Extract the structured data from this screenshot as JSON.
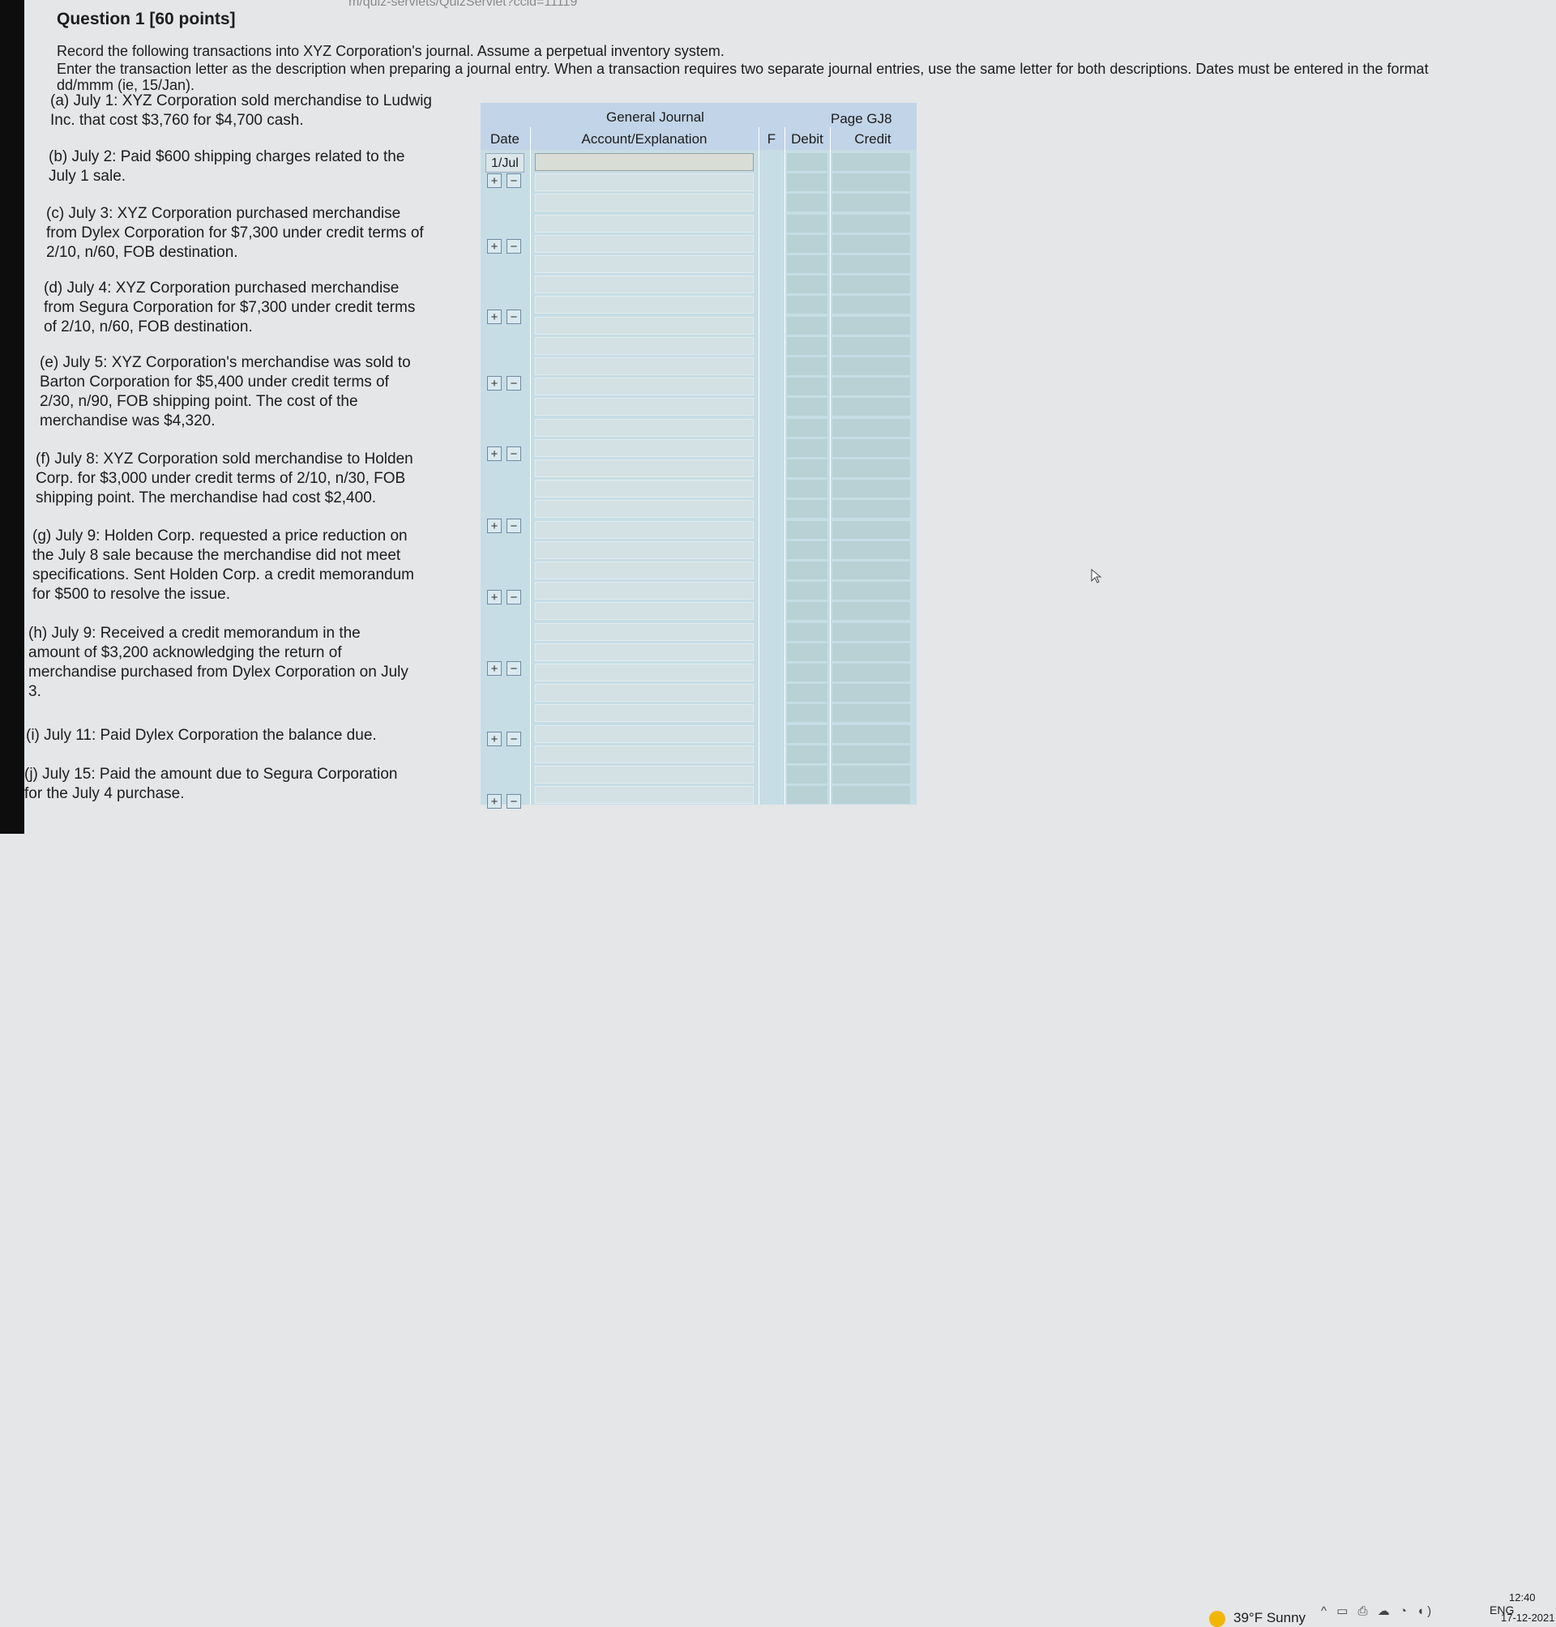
{
  "browser": {
    "url_fragment": "m/quiz-servlets/QuizServlet?ccid=11119"
  },
  "question": {
    "title": "Question 1 [60 points]",
    "instructions": [
      "Record the following transactions into XYZ Corporation's journal. Assume a perpetual inventory system.",
      "Enter the transaction letter as the description when preparing a journal entry. When a transaction requires two separate journal entries, use the same letter for both descriptions. Dates must be entered in the format",
      "dd/mmm (ie, 15/Jan)."
    ]
  },
  "transactions": [
    {
      "lines": [
        "(a) July 1: XYZ Corporation sold merchandise to Ludwig",
        "Inc. that cost $3,760 for $4,700 cash."
      ]
    },
    {
      "lines": [
        "(b) July 2: Paid $600 shipping charges related to the",
        "July 1 sale."
      ]
    },
    {
      "lines": [
        "(c) July 3: XYZ Corporation purchased merchandise",
        "from Dylex Corporation for $7,300 under credit terms of",
        "2/10, n/60, FOB destination."
      ]
    },
    {
      "lines": [
        "(d) July 4: XYZ Corporation purchased merchandise",
        "from Segura Corporation for $7,300 under credit terms",
        "of 2/10, n/60, FOB destination."
      ]
    },
    {
      "lines": [
        "(e) July 5: XYZ Corporation's merchandise was sold to",
        "Barton Corporation for $5,400 under credit terms of",
        "2/30, n/90, FOB shipping point. The cost of the",
        "merchandise was $4,320."
      ]
    },
    {
      "lines": [
        "(f) July 8: XYZ Corporation sold merchandise to Holden",
        "Corp. for $3,000 under credit terms of 2/10, n/30, FOB",
        "shipping point. The merchandise had cost $2,400."
      ]
    },
    {
      "lines": [
        "(g) July 9: Holden Corp. requested a price reduction on",
        "the July 8 sale because the merchandise did not meet",
        "specifications. Sent Holden Corp. a credit memorandum",
        "for $500 to resolve the issue."
      ]
    },
    {
      "lines": [
        "(h) July 9: Received a credit memorandum in the",
        "amount of $3,200 acknowledging the return of",
        "merchandise purchased from Dylex Corporation on July",
        "3."
      ]
    },
    {
      "lines": [
        "(i) July 11: Paid Dylex Corporation the balance due."
      ]
    },
    {
      "lines": [
        "(j) July 15: Paid the amount due to Segura Corporation",
        "for the July 4 purchase."
      ]
    }
  ],
  "journal": {
    "title": "General Journal",
    "page": "Page GJ8",
    "columns": {
      "date": "Date",
      "account": "Account/Explanation",
      "folio": "F",
      "debit": "Debit",
      "credit": "Credit"
    },
    "first_date": "1/Jul",
    "plus": "+",
    "minus": "−"
  },
  "taskbar": {
    "weather": "39°F  Sunny",
    "tray_icons": "^ ▭ ⎙ ☁ ◔ ◖)",
    "language": "ENG",
    "time": "12:40",
    "date": "17-12-2021"
  }
}
